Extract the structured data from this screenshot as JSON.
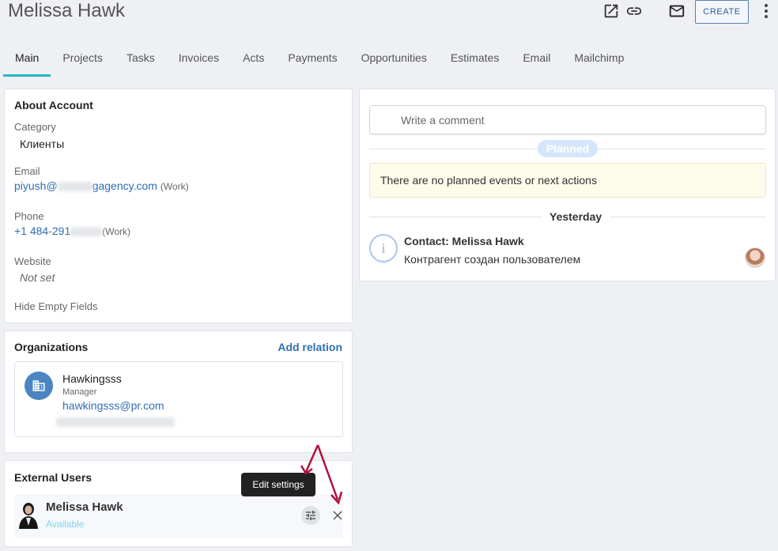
{
  "header": {
    "title": "Melissa Hawk",
    "create_label": "CREATE",
    "icons": [
      "open-in-new-icon",
      "link-icon",
      "mail-icon",
      "more-vert-icon"
    ]
  },
  "tabs": [
    "Main",
    "Projects",
    "Tasks",
    "Invoices",
    "Acts",
    "Payments",
    "Opportunities",
    "Estimates",
    "Email",
    "Mailchimp"
  ],
  "about": {
    "title": "About Account",
    "category_label": "Category",
    "category_value": "Клиенты",
    "email_label": "Email",
    "email_value_start": "piyush@",
    "email_value_end": "gagency.com",
    "email_type": "(Work)",
    "phone_label": "Phone",
    "phone_value": "+1 484-291",
    "phone_type": "(Work)",
    "website_label": "Website",
    "website_value": "Not set",
    "hide_empty": "Hide Empty Fields"
  },
  "organizations": {
    "title": "Organizations",
    "add_relation": "Add relation",
    "org_name": "Hawkingsss",
    "org_role": "Manager",
    "org_email": "hawkingsss@pr.com"
  },
  "external_users": {
    "title": "External Users",
    "user_name": "Melissa Hawk",
    "user_status": "Available",
    "tooltip": "Edit settings"
  },
  "feed": {
    "comment_placeholder": "Write a comment",
    "planned_label": "Planned",
    "no_events": "There are no planned events or next actions",
    "yesterday_label": "Yesterday",
    "event_title": "Contact: Melissa Hawk",
    "event_text": "Контрагент создан пользователем"
  },
  "colors": {
    "accent": "#2bb5c5",
    "link": "#2f6eb2",
    "annotation_arrow": "#b0103a",
    "status_available": "#7fd4e6"
  }
}
